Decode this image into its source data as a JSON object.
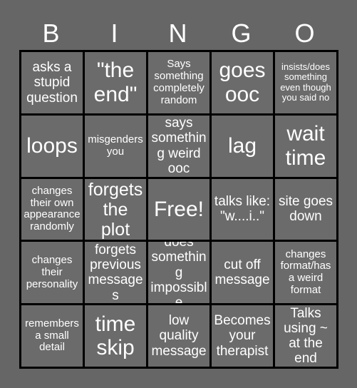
{
  "card": {
    "title": "BINGO",
    "header_letters": [
      "B",
      "I",
      "N",
      "G",
      "O"
    ],
    "background_color": "#666666",
    "cell_color": "#6b6b6b",
    "border_color": "#000000",
    "text_color": "#ffffff",
    "rows": 5,
    "columns": 5,
    "free_space_index": 12
  },
  "cells": [
    {
      "text": "asks a stupid question",
      "size": "md"
    },
    {
      "text": "\"the end\"",
      "size": "xl"
    },
    {
      "text": "Says something completely random",
      "size": "sm"
    },
    {
      "text": "goes ooc",
      "size": "xl"
    },
    {
      "text": "insists/does something even though you said no",
      "size": "xs"
    },
    {
      "text": "loops",
      "size": "xl"
    },
    {
      "text": "misgenders you",
      "size": "sm"
    },
    {
      "text": "says something weird ooc",
      "size": "md"
    },
    {
      "text": "lag",
      "size": "xl"
    },
    {
      "text": "wait time",
      "size": "xl"
    },
    {
      "text": "changes their own appearance randomly",
      "size": "sm"
    },
    {
      "text": "forgets the plot",
      "size": "lg"
    },
    {
      "text": "Free!",
      "size": "xl"
    },
    {
      "text": "talks like: \"w....i..\"",
      "size": "md"
    },
    {
      "text": "site goes down",
      "size": "md"
    },
    {
      "text": "changes their personality",
      "size": "sm"
    },
    {
      "text": "forgets previous messages",
      "size": "md"
    },
    {
      "text": "does something impossible",
      "size": "md"
    },
    {
      "text": "cut off message",
      "size": "md"
    },
    {
      "text": "changes format/has a weird format",
      "size": "sm"
    },
    {
      "text": "remembers a small detail",
      "size": "sm"
    },
    {
      "text": "time skip",
      "size": "xl"
    },
    {
      "text": "low quality message",
      "size": "md"
    },
    {
      "text": "Becomes your therapist",
      "size": "md"
    },
    {
      "text": "Talks using ~ at the end",
      "size": "md"
    }
  ]
}
